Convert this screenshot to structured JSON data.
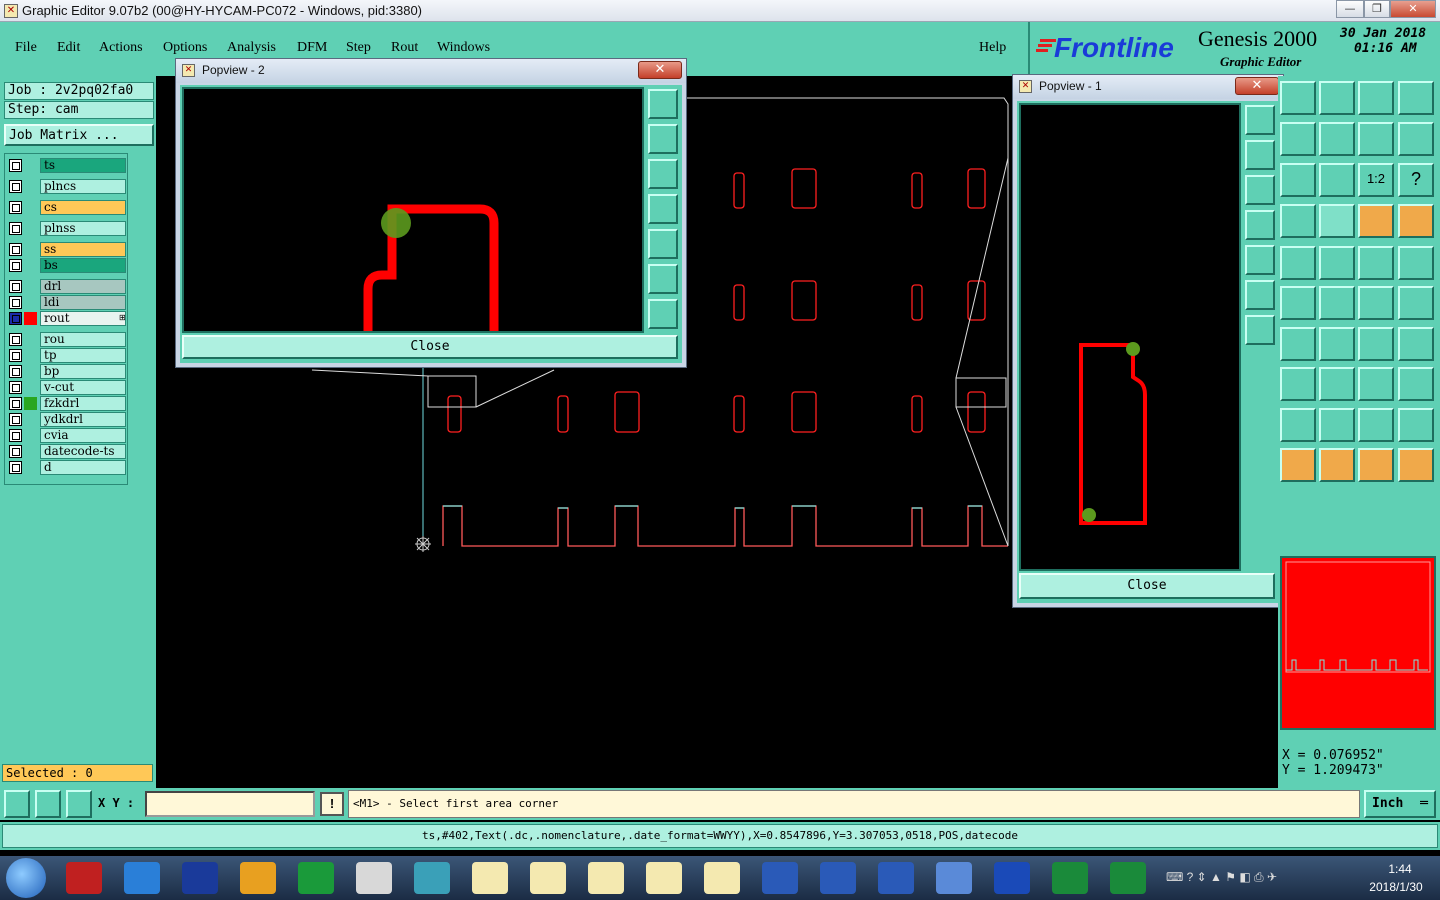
{
  "window": {
    "title": "Graphic Editor 9.07b2 (00@HY-HYCAM-PC072 - Windows, pid:3380)",
    "min_label": "—",
    "max_label": "❐",
    "close_label": "✕"
  },
  "menu": {
    "items": [
      "File",
      "Edit",
      "Actions",
      "Options",
      "Analysis",
      "DFM",
      "Step",
      "Rout",
      "Windows"
    ],
    "help": "Help"
  },
  "brand": {
    "logo": "Frontline",
    "product": "Genesis 2000",
    "subtitle": "Graphic Editor",
    "date": "30 Jan 2018",
    "time": "01:16 AM"
  },
  "job": {
    "job_label": "Job : 2v2pq02fa0",
    "step_label": "Step: cam",
    "matrix_button": "Job Matrix ..."
  },
  "layers": [
    {
      "name": "ts",
      "color": "#1aa67d"
    },
    {
      "name": "plncs",
      "color": "#aef0e0"
    },
    {
      "name": "cs",
      "color": "#ffc857"
    },
    {
      "name": "plnss",
      "color": "#aef0e0"
    },
    {
      "name": "ss",
      "color": "#ffc857"
    },
    {
      "name": "bs",
      "color": "#1aa67d"
    },
    {
      "name": "drl",
      "color": "#a7c7c0"
    },
    {
      "name": "ldi",
      "color": "#a7c7c0"
    },
    {
      "name": "rout",
      "color": "#e8f4f0",
      "active": true
    },
    {
      "name": "rou",
      "color": "#aef0e0"
    },
    {
      "name": "tp",
      "color": "#aef0e0"
    },
    {
      "name": "bp",
      "color": "#aef0e0"
    },
    {
      "name": "v-cut",
      "color": "#aef0e0"
    },
    {
      "name": "fzkdrl",
      "color": "#aef0e0"
    },
    {
      "name": "ydkdrl",
      "color": "#aef0e0"
    },
    {
      "name": "cvia",
      "color": "#aef0e0"
    },
    {
      "name": "datecode-ts",
      "color": "#aef0e0"
    },
    {
      "name": "d",
      "color": "#aef0e0"
    }
  ],
  "selected": "Selected : 0",
  "popview2": {
    "title": "Popview - 2",
    "close_label": "Close"
  },
  "popview1": {
    "title": "Popview - 1",
    "close_label": "Close"
  },
  "coords": {
    "x": "X = 0.076952\"",
    "y": "Y = 1.209473\""
  },
  "bottom": {
    "xy_label": "X Y :",
    "xy_value": "",
    "prompt": "<M1> - Select first area corner",
    "units": "Inch",
    "alert_label": "!"
  },
  "status_line": "ts,#402,Text(.dc,.nomenclature,.date_format=WWYY),X=0.8547896,Y=3.307053,0518,POS,datecode",
  "taskbar": {
    "time": "1:44",
    "date": "2018/1/30"
  },
  "colors": {
    "panel": "#5fd0b4",
    "field": "#aef0e0",
    "accent": "#ffc857",
    "rout": "#ff0000",
    "outline": "#7fe8e0"
  }
}
